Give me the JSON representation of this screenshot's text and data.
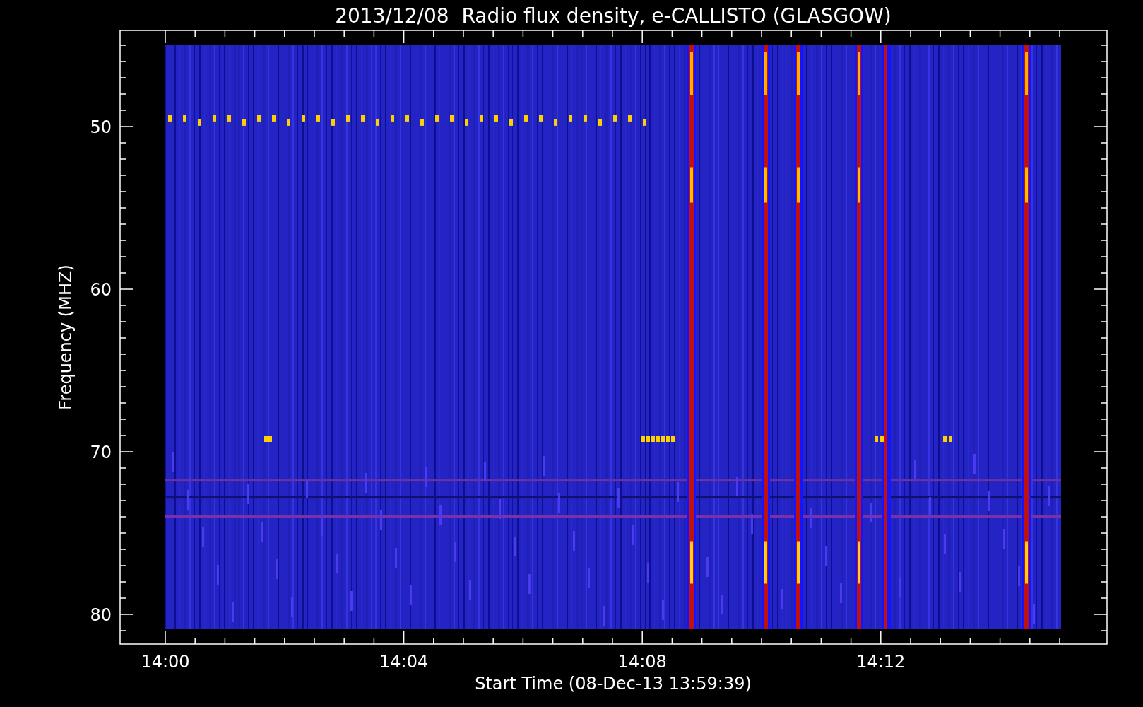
{
  "title": "2013/12/08  Radio flux density, e-CALLISTO (GLASGOW)",
  "y_axis": {
    "label": "Frequency (MHZ)",
    "ticks": [
      "50",
      "60",
      "70",
      "80"
    ]
  },
  "x_axis": {
    "label": "Start Time (08-Dec-13 13:59:39)",
    "ticks": [
      "14:00",
      "14:04",
      "14:08",
      "14:12"
    ]
  }
}
